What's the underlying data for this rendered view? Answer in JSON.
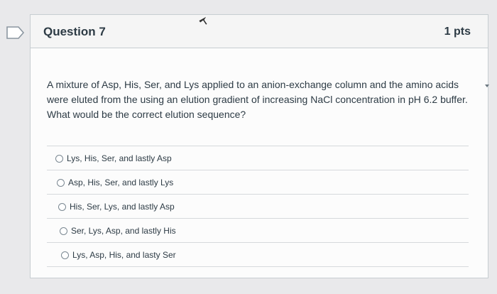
{
  "question": {
    "title": "Question 7",
    "points": "1 pts",
    "text": "A mixture of Asp, His, Ser, and Lys applied to an anion-exchange column and the amino acids were eluted from the using an elution gradient of increasing NaCl concentration in pH 6.2 buffer. What would be the correct elution sequence?"
  },
  "answers": [
    {
      "label": "Lys, His, Ser, and lastly Asp"
    },
    {
      "label": "Asp, His, Ser, and lastly Lys"
    },
    {
      "label": "His, Ser, Lys, and lastly Asp"
    },
    {
      "label": "Ser, Lys, Asp, and lastly His"
    },
    {
      "label": "Lys, Asp, His, and lasty Ser"
    }
  ],
  "icons": {
    "bookmark": "bookmark-flag-icon",
    "cursor": "mouse-pointer-icon"
  },
  "colors": {
    "text": "#2d3b45",
    "border": "#c7cdd1",
    "header_bg": "#f5f5f5"
  }
}
